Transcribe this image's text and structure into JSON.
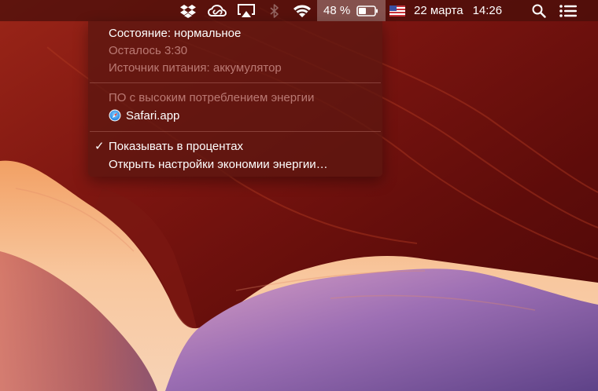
{
  "menubar": {
    "icons": [
      "dropbox-icon",
      "creative-cloud-icon",
      "airplay-icon",
      "bluetooth-icon",
      "wifi-icon",
      "flag-us-icon",
      "spotlight-search-icon",
      "notification-center-icon"
    ],
    "battery": {
      "percent_label": "48 %",
      "level": 0.48
    },
    "date": "22 марта",
    "time": "14:26"
  },
  "battery_menu": {
    "status": "Состояние: нормальное",
    "remaining": "Осталось 3:30",
    "power_source": "Источник питания: аккумулятор",
    "energy_header": "ПО с высоким потреблением энергии",
    "apps": [
      {
        "name": "Safari.app",
        "icon": "safari-icon"
      }
    ],
    "show_percent": {
      "label": "Показывать в процентах",
      "checked": true,
      "check_glyph": "✓"
    },
    "open_settings": "Открыть настройки экономии энергии…"
  },
  "colors": {
    "menubar_bg": "#460e0a",
    "menu_bg": "#5c1610",
    "wallpaper_dark": "#6e0f0c",
    "wallpaper_light": "#f6b58a",
    "wallpaper_violet": "#7a4a9a"
  }
}
